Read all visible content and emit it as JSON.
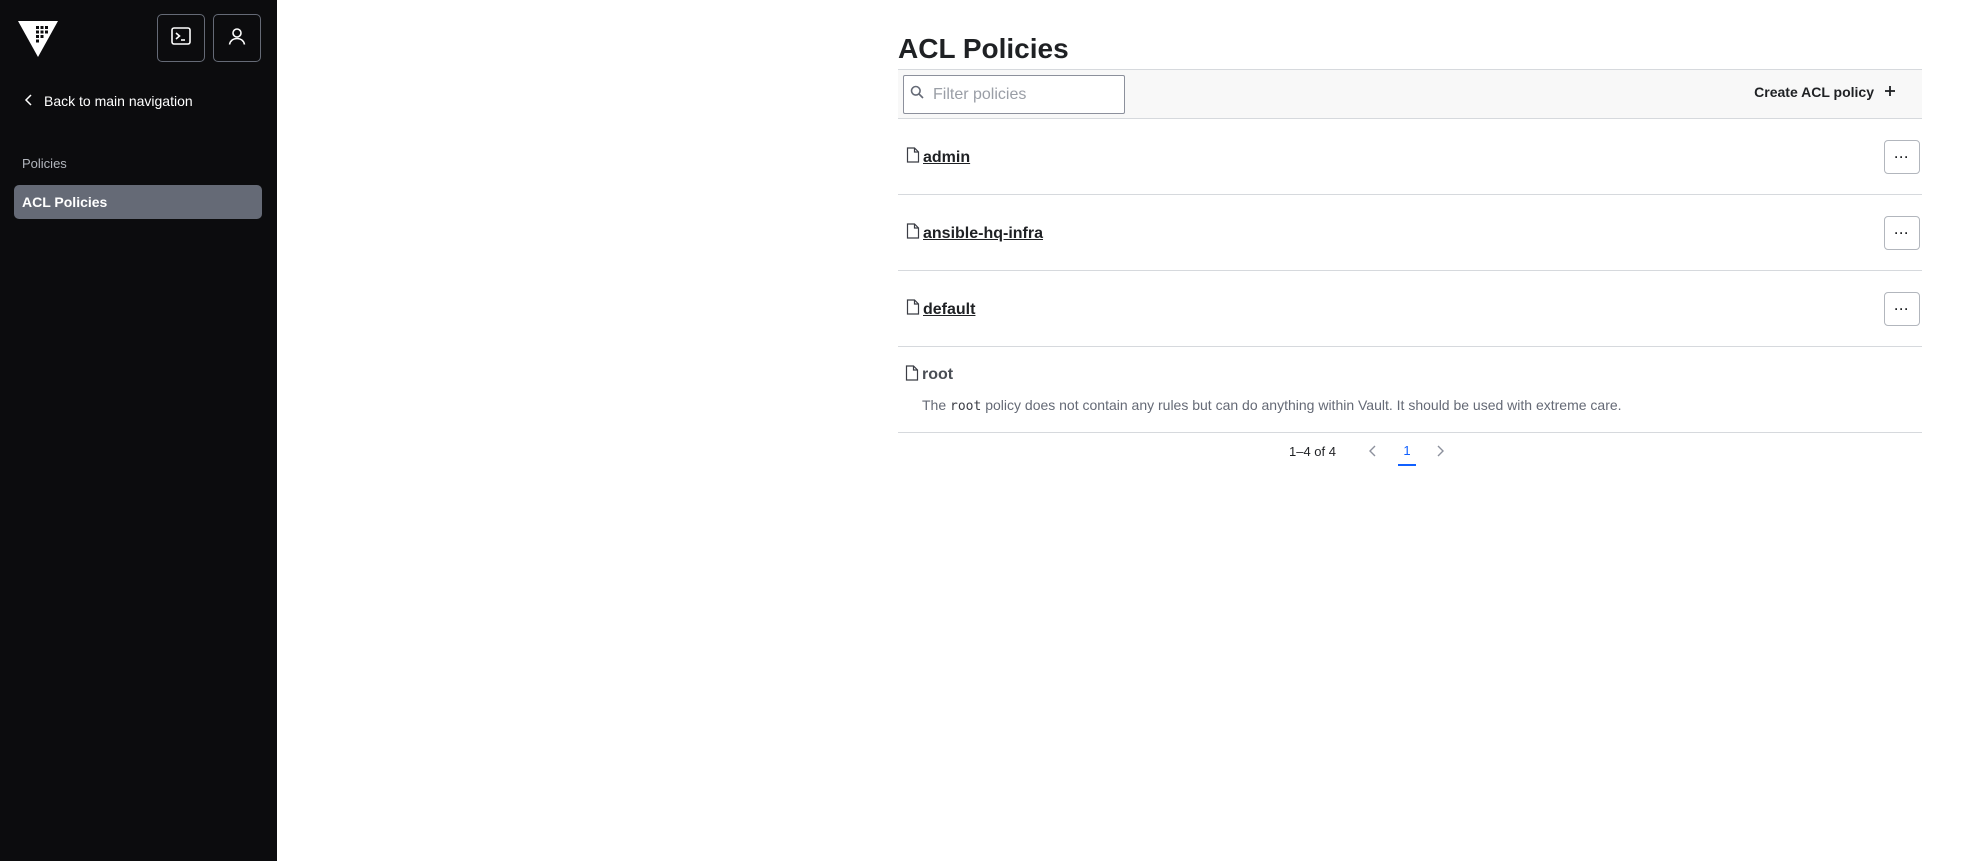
{
  "sidebar": {
    "back_label": "Back to main navigation",
    "section_heading": "Policies",
    "active_item": "ACL Policies"
  },
  "main": {
    "title": "ACL Policies",
    "filter_placeholder": "Filter policies",
    "create_label": "Create ACL policy",
    "policies": [
      {
        "name": "admin"
      },
      {
        "name": "ansible-hq-infra"
      },
      {
        "name": "default"
      }
    ],
    "root": {
      "name": "root",
      "desc_prefix": "The",
      "desc_code": "root",
      "desc_suffix": "policy does not contain any rules but can do anything within Vault. It should be used with extreme care."
    },
    "more_label": "···"
  },
  "pagination": {
    "info": "1–4 of 4",
    "current_page": "1"
  },
  "colors": {
    "sidebar_bg": "#0c0c0e",
    "active_item_bg": "#656a76",
    "accent": "#1060ff"
  }
}
